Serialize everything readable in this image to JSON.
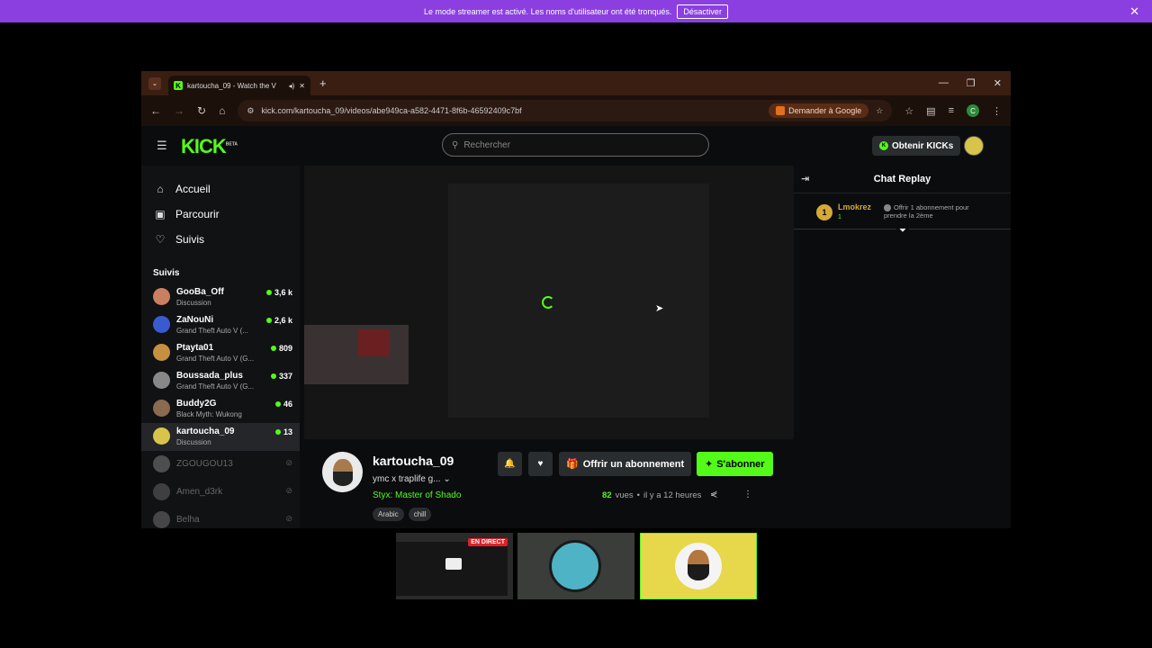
{
  "banner": {
    "message": "Le mode streamer est activé. Les noms d'utilisateur ont été tronqués.",
    "button": "Désactiver",
    "close": "✕"
  },
  "browser": {
    "tab_title": "kartoucha_09 - Watch the V",
    "url": "kick.com/kartoucha_09/videos/abe949ca-a582-4471-8f6b-46592409c7bf",
    "ask_google": "Demander à Google",
    "profile_letter": "C"
  },
  "header": {
    "logo": "KICK",
    "logo_sup": "BETA",
    "search_placeholder": "Rechercher",
    "get_kicks": "Obtenir KICKs"
  },
  "nav": {
    "home": "Accueil",
    "browse": "Parcourir",
    "following": "Suivis"
  },
  "following": {
    "heading": "Suivis",
    "channels": [
      {
        "name": "GooBa_Off",
        "category": "Discussion",
        "viewers": "3,6 k",
        "color": "#c88060"
      },
      {
        "name": "ZaNouNi",
        "category": "Grand Theft Auto V (...",
        "viewers": "2,6 k",
        "color": "#3a5ad0"
      },
      {
        "name": "Ptayta01",
        "category": "Grand Theft Auto V (G...",
        "viewers": "809",
        "color": "#c79040"
      },
      {
        "name": "Boussada_plus",
        "category": "Grand Theft Auto V (G...",
        "viewers": "337",
        "color": "#888888"
      },
      {
        "name": "Buddy2G",
        "category": "Black Myth: Wukong",
        "viewers": "46",
        "color": "#8a6a50"
      },
      {
        "name": "kartoucha_09",
        "category": "Discussion",
        "viewers": "13",
        "color": "#d8c44a"
      }
    ],
    "offline": [
      {
        "name": "ZGOUGOU13",
        "color": "#999999"
      },
      {
        "name": "Amen_d3rk",
        "color": "#777777"
      },
      {
        "name": "Belha",
        "color": "#888888"
      }
    ]
  },
  "chat": {
    "title": "Chat Replay",
    "gift": {
      "rank": "1",
      "user": "Lmokrez",
      "sub_count": "1",
      "message": "Offrir 1 abonnement pour prendre la 2ème"
    }
  },
  "stream": {
    "channel": "kartoucha_09",
    "title": "ymc x traplife g...",
    "game": "Styx: Master of Shado",
    "tags": [
      "Arabic",
      "chill"
    ],
    "gift_sub_label": "Offrir un abonnement",
    "subscribe_label": "S'abonner",
    "views_count": "82",
    "views_label": "vues",
    "separator": "•",
    "time_ago": "il y a 12 heures"
  },
  "thumbnails": {
    "live_badge": "EN DIRECT"
  }
}
